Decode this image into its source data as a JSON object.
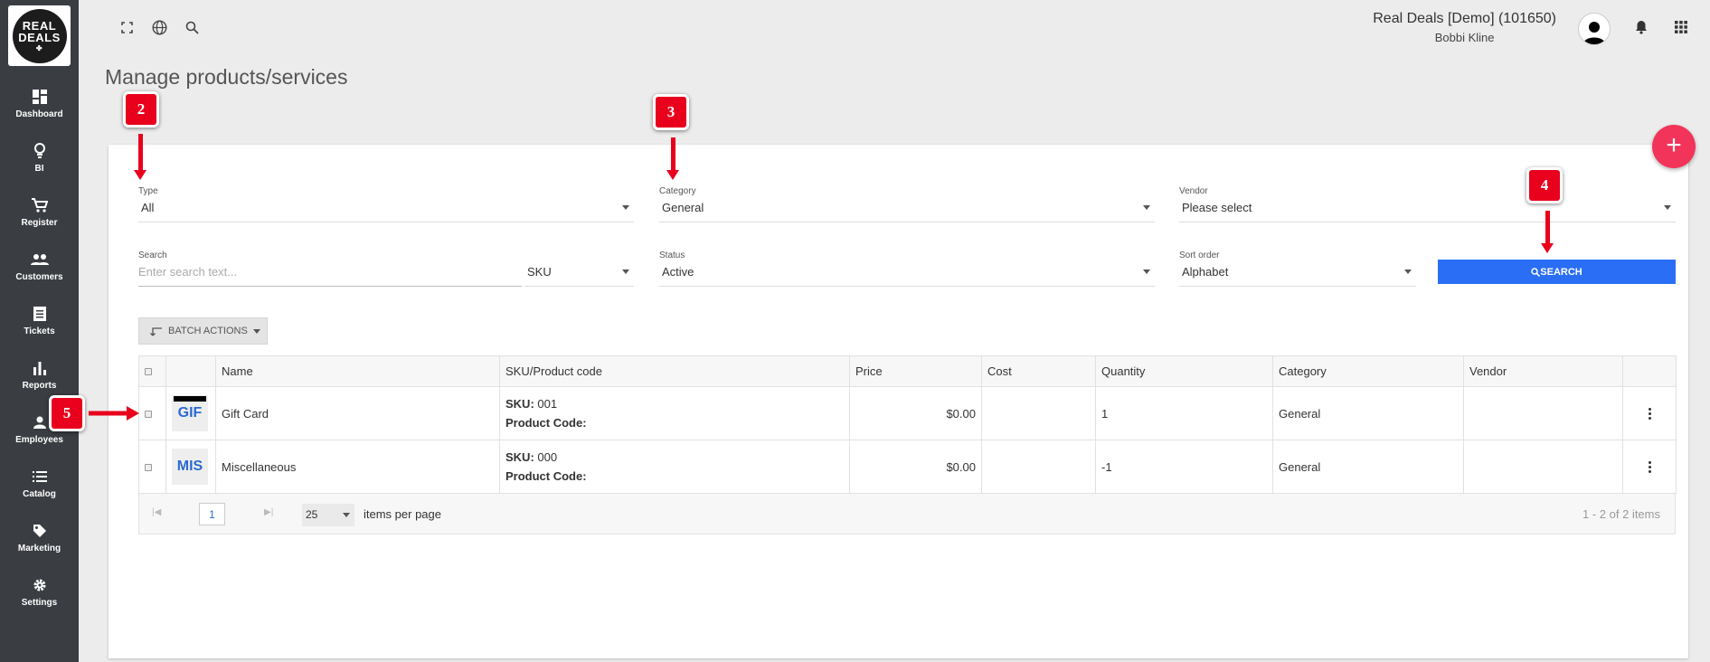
{
  "sidebar": {
    "logo_line1": "REAL",
    "logo_line2": "DEALS",
    "items": [
      {
        "label": "Dashboard",
        "icon": "dashboard-icon"
      },
      {
        "label": "BI",
        "icon": "lightbulb-icon"
      },
      {
        "label": "Register",
        "icon": "cart-icon"
      },
      {
        "label": "Customers",
        "icon": "people-icon"
      },
      {
        "label": "Tickets",
        "icon": "ticket-icon"
      },
      {
        "label": "Reports",
        "icon": "bar-chart-icon"
      },
      {
        "label": "Employees",
        "icon": "person-icon"
      },
      {
        "label": "Catalog",
        "icon": "list-icon"
      },
      {
        "label": "Marketing",
        "icon": "tag-icon"
      },
      {
        "label": "Settings",
        "icon": "gear-icon"
      }
    ]
  },
  "header": {
    "company": "Real Deals [Demo] (101650)",
    "user": "Bobbi Kline"
  },
  "page": {
    "title": "Manage products/services"
  },
  "filters": {
    "type_label": "Type",
    "type_value": "All",
    "category_label": "Category",
    "category_value": "General",
    "vendor_label": "Vendor",
    "vendor_value": "Please select",
    "search_label": "Search",
    "search_placeholder": "Enter search text...",
    "search_field_value": "SKU",
    "status_label": "Status",
    "status_value": "Active",
    "sort_label": "Sort order",
    "sort_value": "Alphabet",
    "search_button": "SEARCH"
  },
  "batch_actions": "BATCH ACTIONS",
  "table": {
    "columns": [
      "Name",
      "SKU/Product code",
      "Price",
      "Cost",
      "Quantity",
      "Category",
      "Vendor"
    ],
    "rows": [
      {
        "thumb": "GIF",
        "name": "Gift Card",
        "sku_label": "SKU:",
        "sku": "001",
        "code_label": "Product Code:",
        "price": "$0.00",
        "cost": "",
        "quantity": "1",
        "category": "General",
        "vendor": ""
      },
      {
        "thumb": "MIS",
        "name": "Miscellaneous",
        "sku_label": "SKU:",
        "sku": "000",
        "code_label": "Product Code:",
        "price": "$0.00",
        "cost": "",
        "quantity": "-1",
        "category": "General",
        "vendor": ""
      }
    ]
  },
  "pager": {
    "current_page": "1",
    "page_size": "25",
    "items_per_page": "items per page",
    "summary": "1 - 2 of 2 items"
  },
  "annotations": [
    "2",
    "3",
    "4",
    "5"
  ],
  "colors": {
    "sidebar": "#3a3d42",
    "primary": "#2a6ef5",
    "fab": "#f2335a",
    "callout": "#e8001c"
  }
}
